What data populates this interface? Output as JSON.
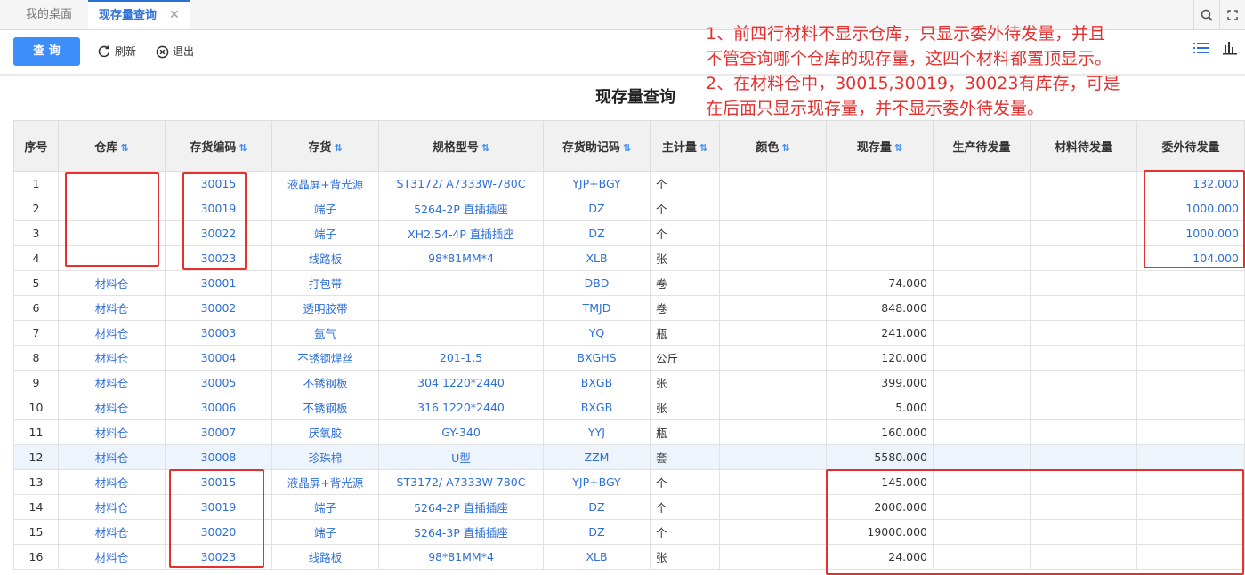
{
  "tabs": [
    {
      "label": "我的桌面"
    },
    {
      "label": "现存量查询",
      "close": "✕"
    }
  ],
  "toolbar": {
    "query": "查 询",
    "refresh": "刷新",
    "exit": "退出"
  },
  "page_title": "现存量查询",
  "annotation": {
    "line1": "1、前四行材料不显示仓库，只显示委外待发量，并且",
    "line2": "不管查询哪个仓库的现存量，这四个材料都置顶显示。",
    "line3": "2、在材料仓中，30015,30019，30023有库存，可是",
    "line4": "在后面只显示现存量，并不显示委外待发量。"
  },
  "columns": [
    "序号",
    "仓库",
    "存货编码",
    "存货",
    "规格型号",
    "存货助记码",
    "主计量",
    "颜色",
    "现存量",
    "生产待发量",
    "材料待发量",
    "委外待发量"
  ],
  "rows": [
    [
      "1",
      "",
      "30015",
      "液晶屏+背光源",
      "ST3172/ A7333W-780C",
      "YJP+BGY",
      "个",
      "",
      "",
      "",
      "",
      "132.000"
    ],
    [
      "2",
      "",
      "30019",
      "端子",
      "5264-2P 直插插座",
      "DZ",
      "个",
      "",
      "",
      "",
      "",
      "1000.000"
    ],
    [
      "3",
      "",
      "30022",
      "端子",
      "XH2.54-4P 直插插座",
      "DZ",
      "个",
      "",
      "",
      "",
      "",
      "1000.000"
    ],
    [
      "4",
      "",
      "30023",
      "线路板",
      "98*81MM*4",
      "XLB",
      "张",
      "",
      "",
      "",
      "",
      "104.000"
    ],
    [
      "5",
      "材料仓",
      "30001",
      "打包带",
      "",
      "DBD",
      "卷",
      "",
      "74.000",
      "",
      "",
      ""
    ],
    [
      "6",
      "材料仓",
      "30002",
      "透明胶带",
      "",
      "TMJD",
      "卷",
      "",
      "848.000",
      "",
      "",
      ""
    ],
    [
      "7",
      "材料仓",
      "30003",
      "氩气",
      "",
      "YQ",
      "瓶",
      "",
      "241.000",
      "",
      "",
      ""
    ],
    [
      "8",
      "材料仓",
      "30004",
      "不锈钢焊丝",
      "201-1.5",
      "BXGHS",
      "公斤",
      "",
      "120.000",
      "",
      "",
      ""
    ],
    [
      "9",
      "材料仓",
      "30005",
      "不锈钢板",
      "304 1220*2440",
      "BXGB",
      "张",
      "",
      "399.000",
      "",
      "",
      ""
    ],
    [
      "10",
      "材料仓",
      "30006",
      "不锈钢板",
      "316 1220*2440",
      "BXGB",
      "张",
      "",
      "5.000",
      "",
      "",
      ""
    ],
    [
      "11",
      "材料仓",
      "30007",
      "厌氧胶",
      "GY-340",
      "YYJ",
      "瓶",
      "",
      "160.000",
      "",
      "",
      ""
    ],
    [
      "12",
      "材料仓",
      "30008",
      "珍珠棉",
      "U型",
      "ZZM",
      "套",
      "",
      "5580.000",
      "",
      "",
      ""
    ],
    [
      "13",
      "材料仓",
      "30015",
      "液晶屏+背光源",
      "ST3172/ A7333W-780C",
      "YJP+BGY",
      "个",
      "",
      "145.000",
      "",
      "",
      ""
    ],
    [
      "14",
      "材料仓",
      "30019",
      "端子",
      "5264-2P 直插插座",
      "DZ",
      "个",
      "",
      "2000.000",
      "",
      "",
      ""
    ],
    [
      "15",
      "材料仓",
      "30020",
      "端子",
      "5264-3P 直插插座",
      "DZ",
      "个",
      "",
      "19000.000",
      "",
      "",
      ""
    ],
    [
      "16",
      "材料仓",
      "30023",
      "线路板",
      "98*81MM*4",
      "XLB",
      "张",
      "",
      "24.000",
      "",
      "",
      ""
    ]
  ],
  "sortable": [
    false,
    true,
    true,
    true,
    true,
    true,
    true,
    true,
    true,
    false,
    false,
    false
  ],
  "colors": {
    "accent": "#3d8ef8",
    "link": "#2d6fd9",
    "annotation": "#e53030"
  },
  "icons": [
    "search-icon",
    "fullscreen-icon",
    "refresh-icon",
    "exit-icon",
    "list-icon",
    "bar-chart-icon",
    "sort-icon",
    "close-icon"
  ]
}
